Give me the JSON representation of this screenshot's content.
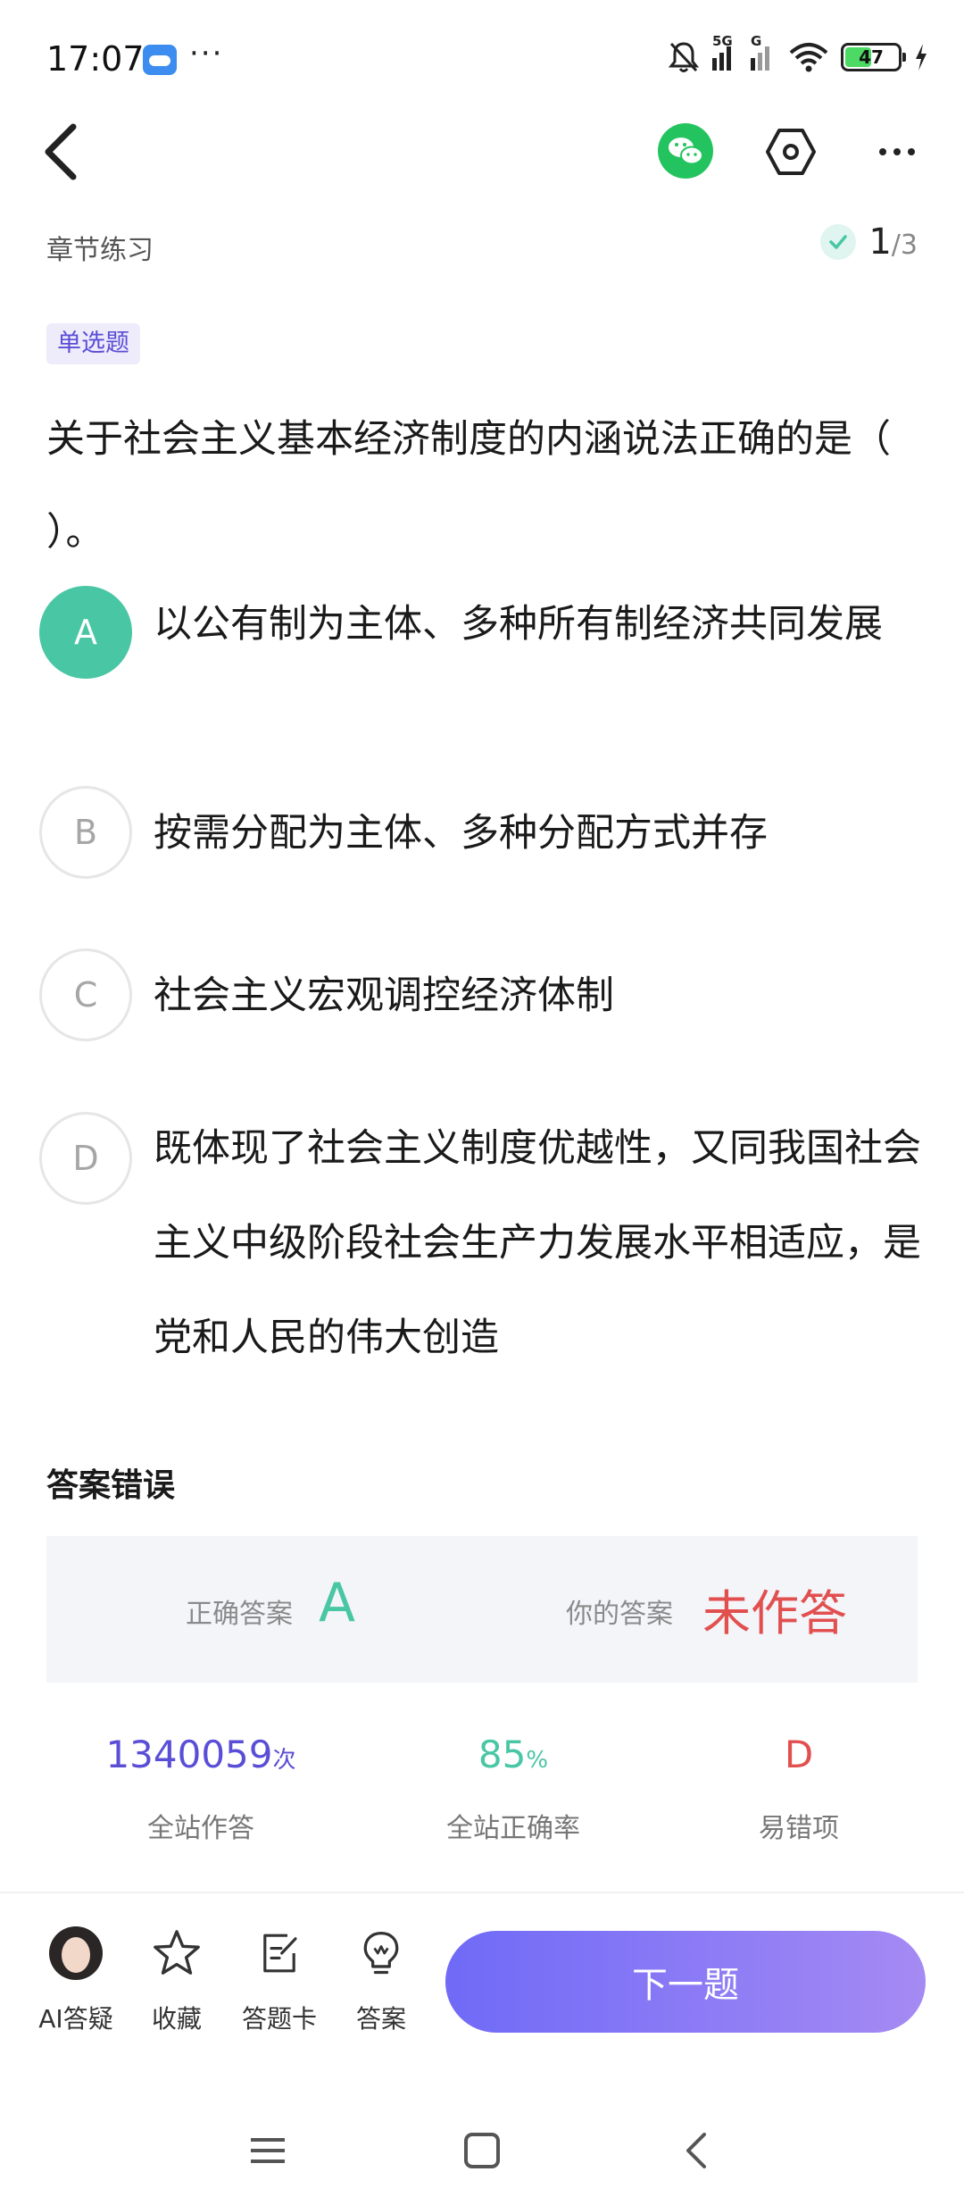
{
  "status_bar": {
    "time": "17:07",
    "dots": "···",
    "signal1_tag": "5G",
    "signal2_tag": "G",
    "battery": "47"
  },
  "nav": {
    "back_icon": "back-chevron-icon",
    "share_icon": "wechat-icon",
    "settings_icon": "hexagon-settings-icon",
    "more_icon": "more-dots-icon"
  },
  "section": {
    "title": "章节练习",
    "progress_current": "1",
    "progress_total": "/3"
  },
  "question": {
    "type": "单选题",
    "text": "关于社会主义基本经济制度的内涵说法正确的是（ ）。",
    "options": [
      {
        "letter": "A",
        "text": "以公有制为主体、多种所有制经济共同发展",
        "correct": true
      },
      {
        "letter": "B",
        "text": "按需分配为主体、多种分配方式并存",
        "correct": false
      },
      {
        "letter": "C",
        "text": "社会主义宏观调控经济体制",
        "correct": false
      },
      {
        "letter": "D",
        "text": "既体现了社会主义制度优越性，又同我国社会主义中级阶段社会生产力发展水平相适应，是党和人民的伟大创造",
        "correct": false
      }
    ]
  },
  "result": {
    "title": "答案错误",
    "correct_label": "正确答案",
    "correct_value": "A",
    "your_label": "你的答案",
    "your_value": "未作答"
  },
  "stats": [
    {
      "value": "1340059",
      "unit": "次",
      "label": "全站作答",
      "color": "#5a4ed6"
    },
    {
      "value": "85",
      "unit": "%",
      "label": "全站正确率",
      "color": "#49c6a4"
    },
    {
      "value": "D",
      "unit": "",
      "label": "易错项",
      "color": "#e24f4f"
    }
  ],
  "toolbar": {
    "ai_label": "AI答疑",
    "favorite_label": "收藏",
    "answer_card_label": "答题卡",
    "answer_label": "答案",
    "next_label": "下一题"
  },
  "colors": {
    "accent": "#5a4ed6",
    "correct": "#49c6a4",
    "wrong": "#e24f4f"
  }
}
